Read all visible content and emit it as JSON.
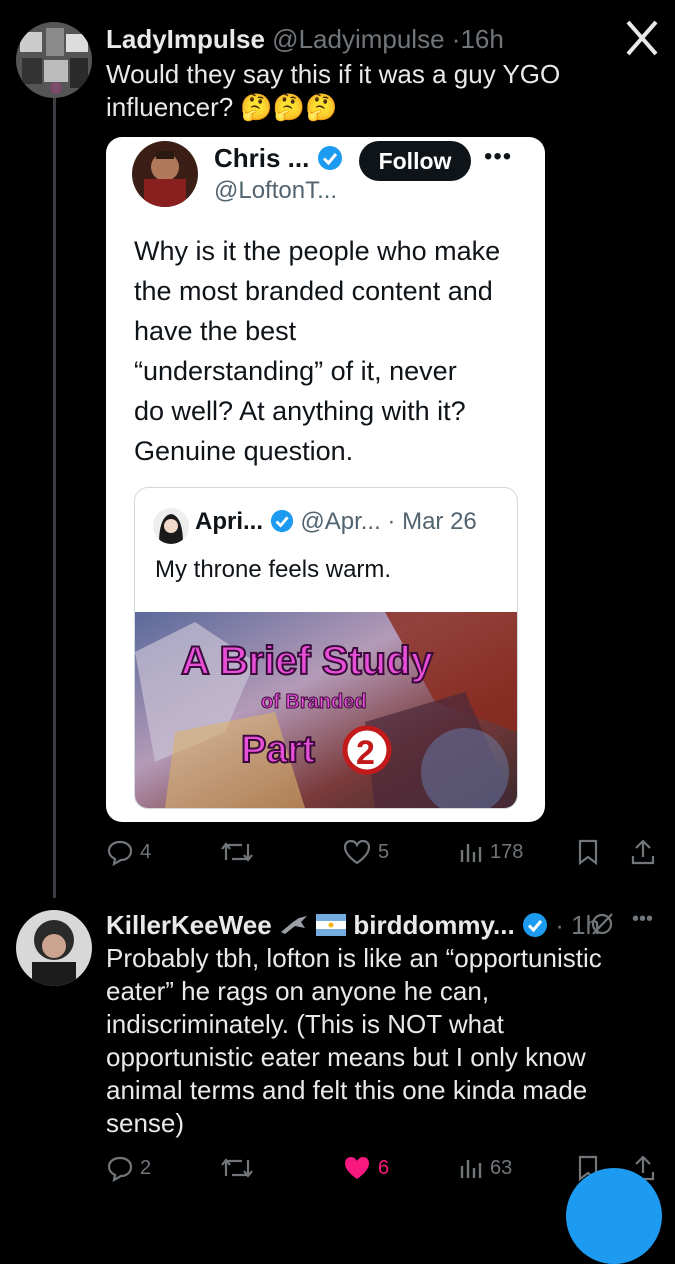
{
  "close_icon": "x-logo-icon",
  "tweet1": {
    "display_name": "LadyImpulse",
    "handle": "@Ladyimpulse",
    "time": "16h",
    "text_line1": "Would they say this if it was a guy YGO",
    "text_line2": "influencer? 🤔🤔🤔",
    "embed": {
      "display_name": "Chris ...",
      "handle": "@LoftonT...",
      "follow_label": "Follow",
      "more": "•••",
      "text_lines": [
        "Why is it the people who make",
        "the most branded content and",
        "have the best",
        "“understanding” of it, never",
        "do well? At anything with it?",
        "Genuine question."
      ],
      "quote": {
        "display_name": "Apri...",
        "handle": "@Apr...",
        "date": "· Mar 26",
        "text": "My throne feels warm.",
        "image_title": "A Brief Study",
        "image_sub": "of Branded",
        "image_part": "Part",
        "image_num": "2"
      }
    },
    "actions": {
      "replies": "4",
      "likes": "5",
      "views": "178"
    }
  },
  "tweet2": {
    "display_name": "KillerKeeWee",
    "name_suffix": "birddommy...",
    "time": "· 1h",
    "text_lines": [
      "Probably tbh, lofton is like an “opportunistic",
      "eater” he rags on anyone he can,",
      "indiscriminately. (This is NOT what",
      "opportunistic eater means but I only know",
      "animal terms and felt this one kinda made",
      "sense)"
    ],
    "actions": {
      "replies": "2",
      "likes": "6",
      "views": "63"
    }
  },
  "colors": {
    "like_active": "#f91880",
    "verified": "#1d9bf0",
    "muted": "#71767b"
  }
}
